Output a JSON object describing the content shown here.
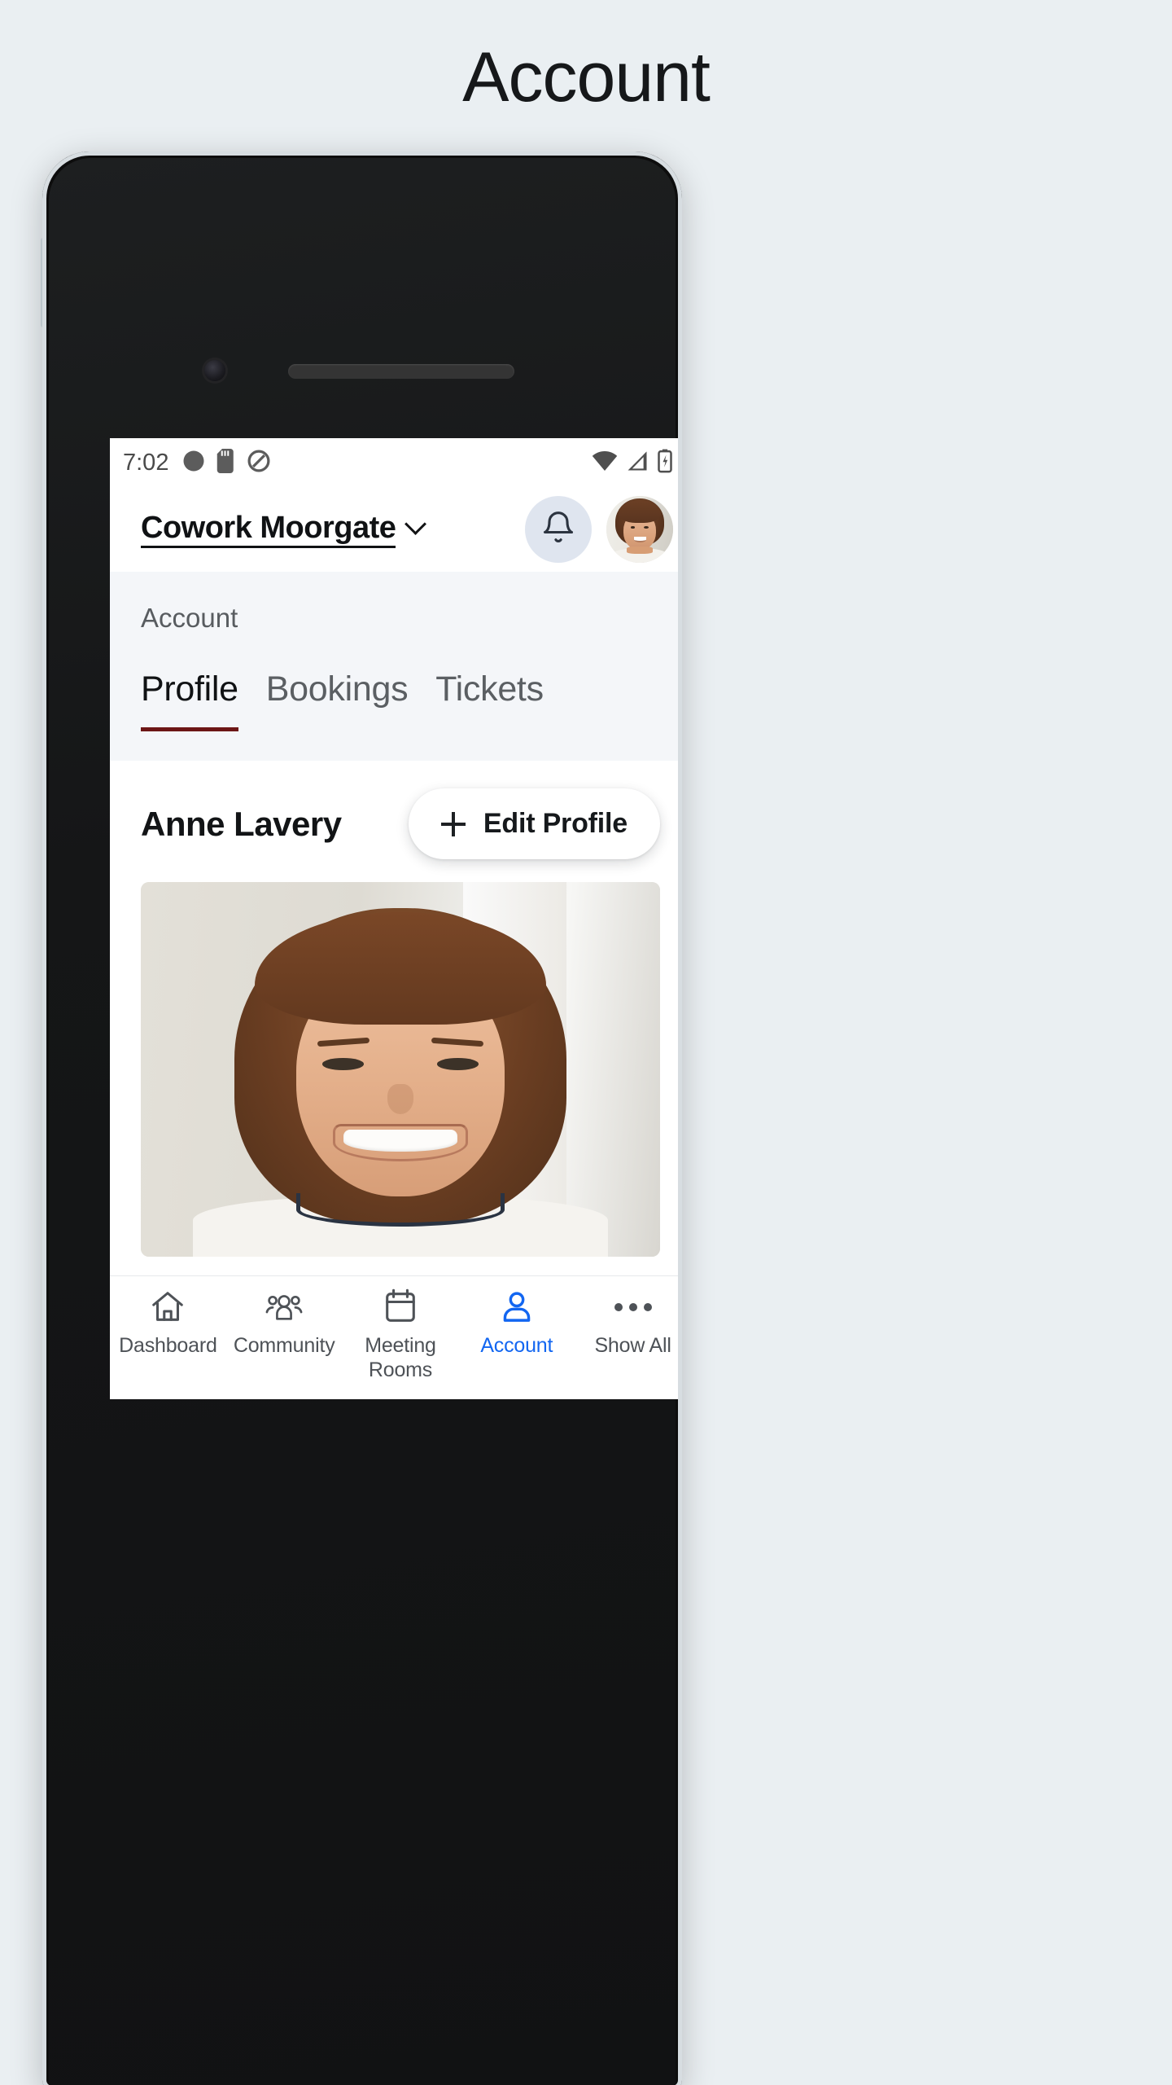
{
  "page": {
    "title": "Account",
    "background_color": "#eaeff2"
  },
  "status_bar": {
    "time": "7:02",
    "left_icons": [
      "sync-app-icon",
      "sd-card-icon",
      "do-not-disturb-icon"
    ],
    "right_icons": [
      "wifi-icon",
      "cellular-signal-icon",
      "battery-charging-icon"
    ]
  },
  "app_header": {
    "location_name": "Cowork Moorgate",
    "location_chevron": "chevron-down-icon",
    "notification_icon": "bell-icon",
    "avatar": "user-avatar"
  },
  "section": {
    "label": "Account",
    "tabs": [
      {
        "label": "Profile",
        "active": true
      },
      {
        "label": "Bookings",
        "active": false
      },
      {
        "label": "Tickets",
        "active": false
      }
    ],
    "active_tab_color": "#6c1616"
  },
  "profile": {
    "name": "Anne Lavery",
    "edit_button": {
      "label": "Edit Profile",
      "icon": "plus-icon"
    },
    "photo_alt": "profile-photo"
  },
  "bottom_nav": {
    "active_color": "#1266f1",
    "items": [
      {
        "label": "Dashboard",
        "icon": "home-icon",
        "active": false
      },
      {
        "label": "Community",
        "icon": "people-icon",
        "active": false
      },
      {
        "label": "Meeting Rooms",
        "icon": "calendar-icon",
        "active": false
      },
      {
        "label": "Account",
        "icon": "person-icon",
        "active": true
      },
      {
        "label": "Show All",
        "icon": "ellipsis-icon",
        "active": false
      }
    ]
  }
}
